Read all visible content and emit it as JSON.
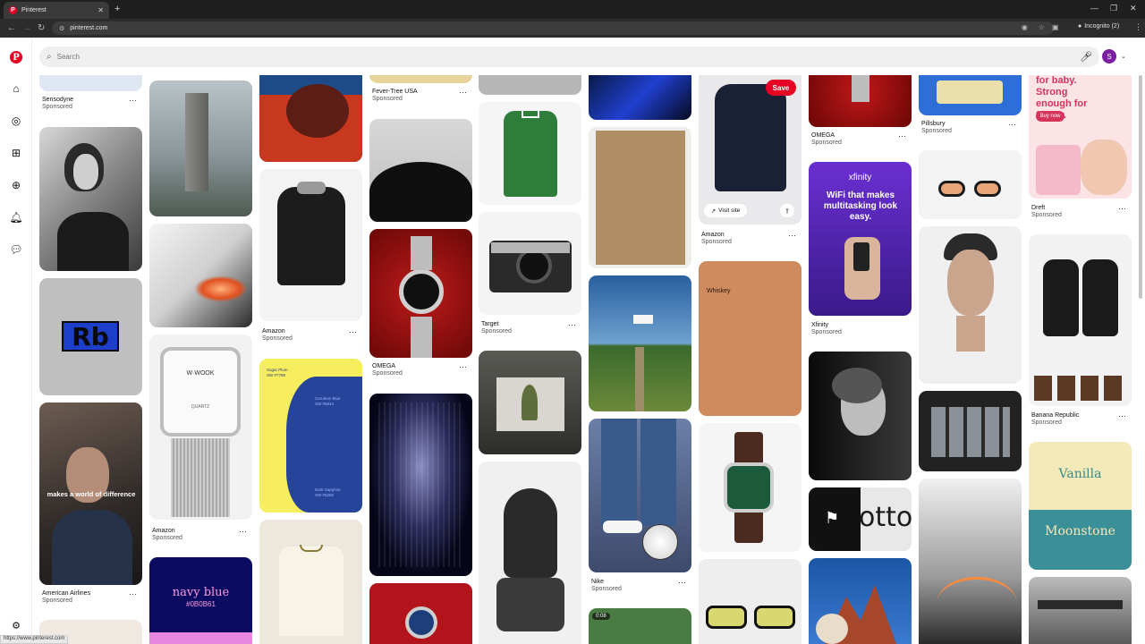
{
  "browser": {
    "tab_title": "Pinterest",
    "url": "pinterest.com",
    "incognito_label": "Incognito (2)",
    "status_url": "https://www.pinterest.com"
  },
  "search": {
    "placeholder": "Search"
  },
  "profile": {
    "initial": "S"
  },
  "pin_actions": {
    "save": "Save",
    "visit_site": "Visit site"
  },
  "pins": {
    "sensodyne": {
      "brand": "Sensodyne",
      "label": "Sponsored"
    },
    "american_airlines": {
      "brand": "American Airlines",
      "label": "Sponsored",
      "overlay": "makes a world of difference"
    },
    "rb_logo": {
      "text": "Rb"
    },
    "amazon_watch": {
      "brand": "Amazon",
      "label": "Sponsored",
      "dial": "W·WOOK",
      "dial_sub": "QUARTZ"
    },
    "navy_blue": {
      "title": "navy blue",
      "code": "#0B0B61"
    },
    "amazon_jacket": {
      "brand": "Amazon",
      "label": "Sponsored"
    },
    "swatch_card": {
      "tl": "Sugar Plum",
      "tl_code": "SW #7798",
      "mid": "Cerulean Blue",
      "mid_code": "SW #6814",
      "br": "Dark Sapphire",
      "br_code": "SW #6256"
    },
    "fever_tree": {
      "brand": "Fever-Tree USA",
      "label": "Sponsored"
    },
    "omega_red": {
      "brand": "OMEGA",
      "label": "Sponsored"
    },
    "target": {
      "brand": "Target",
      "label": "Sponsored"
    },
    "nike": {
      "brand": "Nike",
      "label": "Sponsored"
    },
    "video_badge": {
      "text": "0:08"
    },
    "amazon_sweater": {
      "brand": "Amazon",
      "label": "Sponsored"
    },
    "whiskey": {
      "title": "Whiskey"
    },
    "omega_top": {
      "brand": "OMEGA",
      "label": "Sponsored"
    },
    "xfinity": {
      "brand": "Xfinity",
      "label": "Sponsored",
      "logo": "xfinity",
      "headline": "WiFi that makes multitasking look easy."
    },
    "otto": {
      "text": "otto"
    },
    "pillsbury": {
      "brand": "Pillsbury",
      "label": "Sponsored"
    },
    "dreft": {
      "brand": "Dreft",
      "label": "Sponsored",
      "headline": "for baby. Strong enough for family.",
      "cta": "Buy now"
    },
    "banana_republic": {
      "brand": "Banana Republic",
      "label": "Sponsored"
    },
    "vanilla_moonstone": {
      "top": "Vanilla",
      "bottom": "Moonstone"
    }
  }
}
